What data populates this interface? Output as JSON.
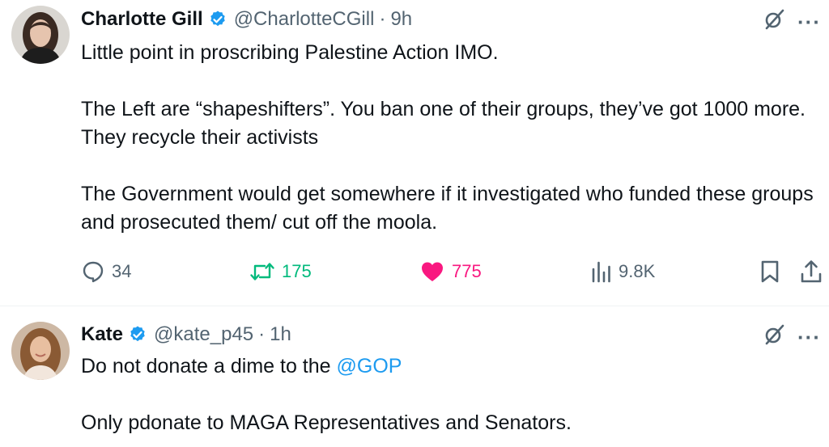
{
  "tweets": [
    {
      "display_name": "Charlotte Gill",
      "handle": "@CharlotteCGill",
      "separator": "·",
      "time": "9h",
      "paragraphs": [
        "Little point in proscribing Palestine Action IMO.",
        "The Left are “shapeshifters”. You ban one of their groups, they’ve got 1000 more. They recycle their activists",
        "The Government would get somewhere if it investigated who funded these groups and prosecuted them/ cut off the moola."
      ],
      "replies": "34",
      "reposts": "175",
      "likes": "775",
      "views": "9.8K",
      "more_icon": "···"
    },
    {
      "display_name": "Kate",
      "handle": "@kate_p45",
      "separator": "·",
      "time": "1h",
      "line1_text": "Do not donate a dime to the ",
      "line1_mention": "@GOP",
      "line2_text": "Only pdonate to MAGA Representatives and Senators.",
      "more_icon": "···"
    }
  ],
  "colors": {
    "verified_blue": "#1d9bf0",
    "like_pink": "#f91880",
    "repost_green": "#00ba7c",
    "secondary_gray": "#536471",
    "mention_blue": "#1d9bf0"
  },
  "icons": [
    "verified-badge-icon",
    "grok-icon",
    "more-icon",
    "reply-icon",
    "repost-icon",
    "heart-icon",
    "views-icon",
    "bookmark-icon",
    "share-icon"
  ]
}
